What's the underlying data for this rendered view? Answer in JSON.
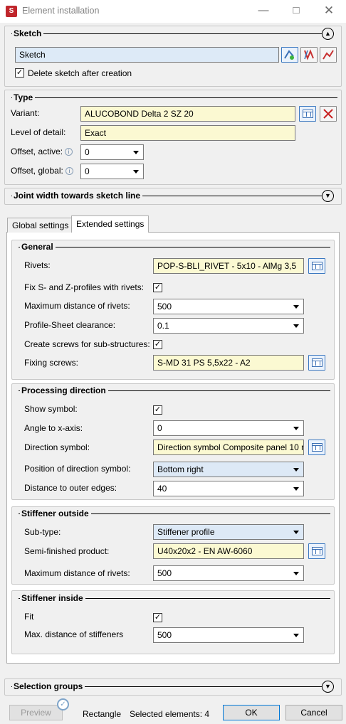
{
  "window": {
    "title": "Element installation",
    "controls": [
      "minimize",
      "maximize",
      "close"
    ]
  },
  "sketch": {
    "heading": "Sketch",
    "value": "Sketch",
    "delete_after_label": "Delete sketch after creation",
    "delete_after_checked": true
  },
  "type": {
    "heading": "Type",
    "variant_label": "Variant:",
    "variant_value": "ALUCOBOND Delta 2 SZ 20",
    "lod_label": "Level of detail:",
    "lod_value": "Exact",
    "offset_active_label": "Offset, active:",
    "offset_active_value": "0",
    "offset_global_label": "Offset, global:",
    "offset_global_value": "0"
  },
  "joint": {
    "heading": "Joint width towards sketch line"
  },
  "tabs": [
    {
      "label": "Global settings"
    },
    {
      "label": "Extended settings"
    }
  ],
  "active_tab": "Extended settings",
  "general": {
    "heading": "General",
    "rivets_label": "Rivets:",
    "rivets_value": "POP-S-BLI_RIVET -  5x10 - AlMg 3,5",
    "fix_label": "Fix S- and Z-profiles with rivets:",
    "fix_checked": true,
    "maxdist_label": "Maximum distance of rivets:",
    "maxdist_value": "500",
    "clearance_label": "Profile-Sheet clearance:",
    "clearance_value": "0.1",
    "screws_sub_label": "Create screws for sub-structures:",
    "screws_sub_checked": true,
    "fixing_label": "Fixing screws:",
    "fixing_value": "S-MD 31 PS 5,5x22 - A2"
  },
  "processing": {
    "heading": "Processing direction",
    "show_label": "Show symbol:",
    "show_checked": true,
    "angle_label": "Angle to x-axis:",
    "angle_value": "0",
    "symbol_label": "Direction symbol:",
    "symbol_value": "Direction symbol Composite panel 10 r",
    "position_label": "Position of direction symbol:",
    "position_value": "Bottom right",
    "distance_label": "Distance to outer edges:",
    "distance_value": "40"
  },
  "stiff_out": {
    "heading": "Stiffener outside",
    "subtype_label": "Sub-type:",
    "subtype_value": "Stiffener profile",
    "semi_label": "Semi-finished product:",
    "semi_value": "U40x20x2 - EN AW-6060",
    "maxdist_label": "Maximum distance of rivets:",
    "maxdist_value": "500"
  },
  "stiff_in": {
    "heading": "Stiffener inside",
    "fit_label": "Fit",
    "fit_checked": true,
    "maxdist_label": "Max. distance of stiffeners",
    "maxdist_value": "500"
  },
  "selection_groups": {
    "heading": "Selection groups"
  },
  "footer": {
    "preview_label": "Preview",
    "mode_text": "Rectangle",
    "selected_text": "Selected elements: 4",
    "ok_label": "OK",
    "cancel_label": "Cancel"
  }
}
